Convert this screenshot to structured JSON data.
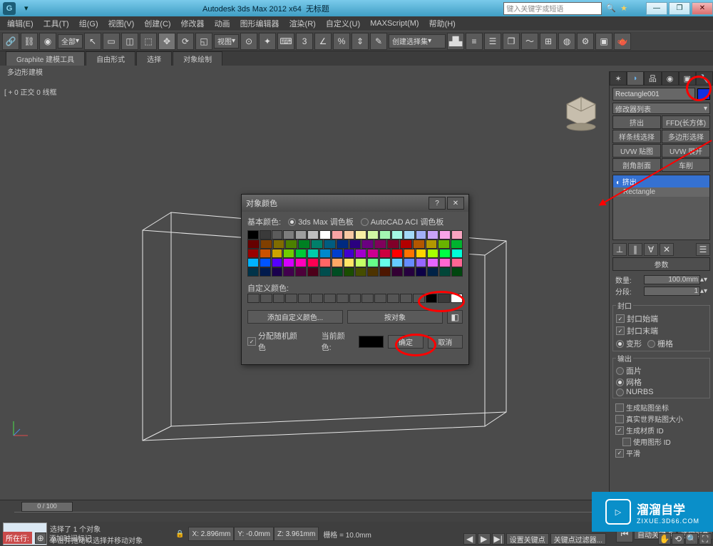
{
  "title": {
    "app": "Autodesk 3ds Max 2012 x64",
    "doc": "无标题",
    "search_placeholder": "键入关键字或短语"
  },
  "menubar": [
    "编辑(E)",
    "工具(T)",
    "组(G)",
    "视图(V)",
    "创建(C)",
    "修改器",
    "动画",
    "图形编辑器",
    "渲染(R)",
    "自定义(U)",
    "MAXScript(M)",
    "帮助(H)"
  ],
  "toolbar": {
    "selset": "全部",
    "viewlabel": "视图",
    "createset": "创建选择集"
  },
  "tabs": {
    "graphite": "Graphite 建模工具",
    "t1": "自由形式",
    "t2": "选择",
    "t3": "对象绘制",
    "sub": "多边形建模"
  },
  "viewport": {
    "label": "[ + 0 正交 0 线框"
  },
  "cmd": {
    "object_name": "Rectangle001",
    "modlist": "修改器列表",
    "mods": [
      "挤出",
      "FFD(长方体)",
      "样条线选择",
      "多边形选择",
      "UVW 贴图",
      "UVW 展开",
      "剖角剖面",
      "车削"
    ],
    "stack": [
      "挤出",
      "Rectangle"
    ],
    "roll_params": "参数",
    "amount_label": "数量:",
    "amount_val": "100.0mm",
    "segs_label": "分段:",
    "segs_val": "1",
    "capping": "封口",
    "cap_start": "封口始端",
    "cap_end": "封口末端",
    "morph": "变形",
    "grid": "栅格",
    "output": "输出",
    "patch": "面片",
    "mesh": "网格",
    "nurbs": "NURBS",
    "gen_map": "生成贴图坐标",
    "real_world": "真实世界贴图大小",
    "gen_mat": "生成材质 ID",
    "use_shape": "使用图形 ID",
    "smooth": "平滑"
  },
  "dlg": {
    "title": "对象颜色",
    "basic": "基本颜色:",
    "pal_3ds": "3ds Max 调色板",
    "pal_aci": "AutoCAD ACI 调色板",
    "custom": "自定义颜色:",
    "add_custom": "添加自定义颜色...",
    "by_object": "按对象",
    "assign_random": "分配随机颜色",
    "current": "当前颜色:",
    "ok": "确定",
    "cancel": "取消"
  },
  "status": {
    "sel": "选择了 1 个对象",
    "hint": "单击并拖动以选择并移动对象",
    "x": "X: 2.896mm",
    "y": "Y: -0.0mm",
    "z": "Z: 3.961mm",
    "grid": "栅格 = 10.0mm",
    "autokey": "自动关键点",
    "selsets": "选定对象",
    "setkey": "设置关键点",
    "keyfilter": "关键点过滤器...",
    "now": "所在行:",
    "addtag": "添加时间标记",
    "frame": "0 / 100"
  },
  "watermark": {
    "brand": "溜溜自学",
    "url": "ZIXUE.3D66.COM"
  },
  "palette": [
    [
      "#000",
      "#3a3a3a",
      "#5b5b5b",
      "#7d7d7d",
      "#9e9e9e",
      "#bfbfbf",
      "#fff",
      "#f7a3a3",
      "#f7c8a3",
      "#f7eea3",
      "#d0f7a3",
      "#a3f7b1",
      "#a3f7e3",
      "#a3d9f7",
      "#a3b0f7",
      "#c9a3f7",
      "#f7a3e8",
      "#f7a3c0"
    ],
    [
      "#660000",
      "#803f00",
      "#806c00",
      "#4b8000",
      "#008022",
      "#00806a",
      "#005c80",
      "#002a80",
      "#2a0080",
      "#6a0080",
      "#80005c",
      "#800029",
      "#b30000",
      "#b35700",
      "#b39800",
      "#69b300",
      "#00b32f"
    ],
    [
      "#990000",
      "#cc5200",
      "#cca300",
      "#70cc00",
      "#00cc36",
      "#00ccab",
      "#0089cc",
      "#003ecc",
      "#4100cc",
      "#a300cc",
      "#cc0091",
      "#cc003f",
      "#ff0000",
      "#ff7300",
      "#ffd400",
      "#a7ff00",
      "#00ff45",
      "#00ffd8"
    ],
    [
      "#00b3ff",
      "#0054ff",
      "#5500ff",
      "#d400ff",
      "#ff00bb",
      "#ff0052",
      "#ff6666",
      "#ffa866",
      "#ffe566",
      "#c4ff66",
      "#66ff8a",
      "#66ffe8",
      "#66ccff",
      "#668cff",
      "#9666ff",
      "#e666ff",
      "#ff66d2",
      "#ff6694"
    ],
    [
      "#003349",
      "#001a4d",
      "#1a004d",
      "#41004d",
      "#4d003a",
      "#4d0019",
      "#004d4d",
      "#004d22",
      "#1a4d00",
      "#454d00",
      "#4d3300",
      "#4d1600",
      "#330033",
      "#26003f",
      "#0c0046",
      "#002246",
      "#004638",
      "#00460f"
    ]
  ]
}
